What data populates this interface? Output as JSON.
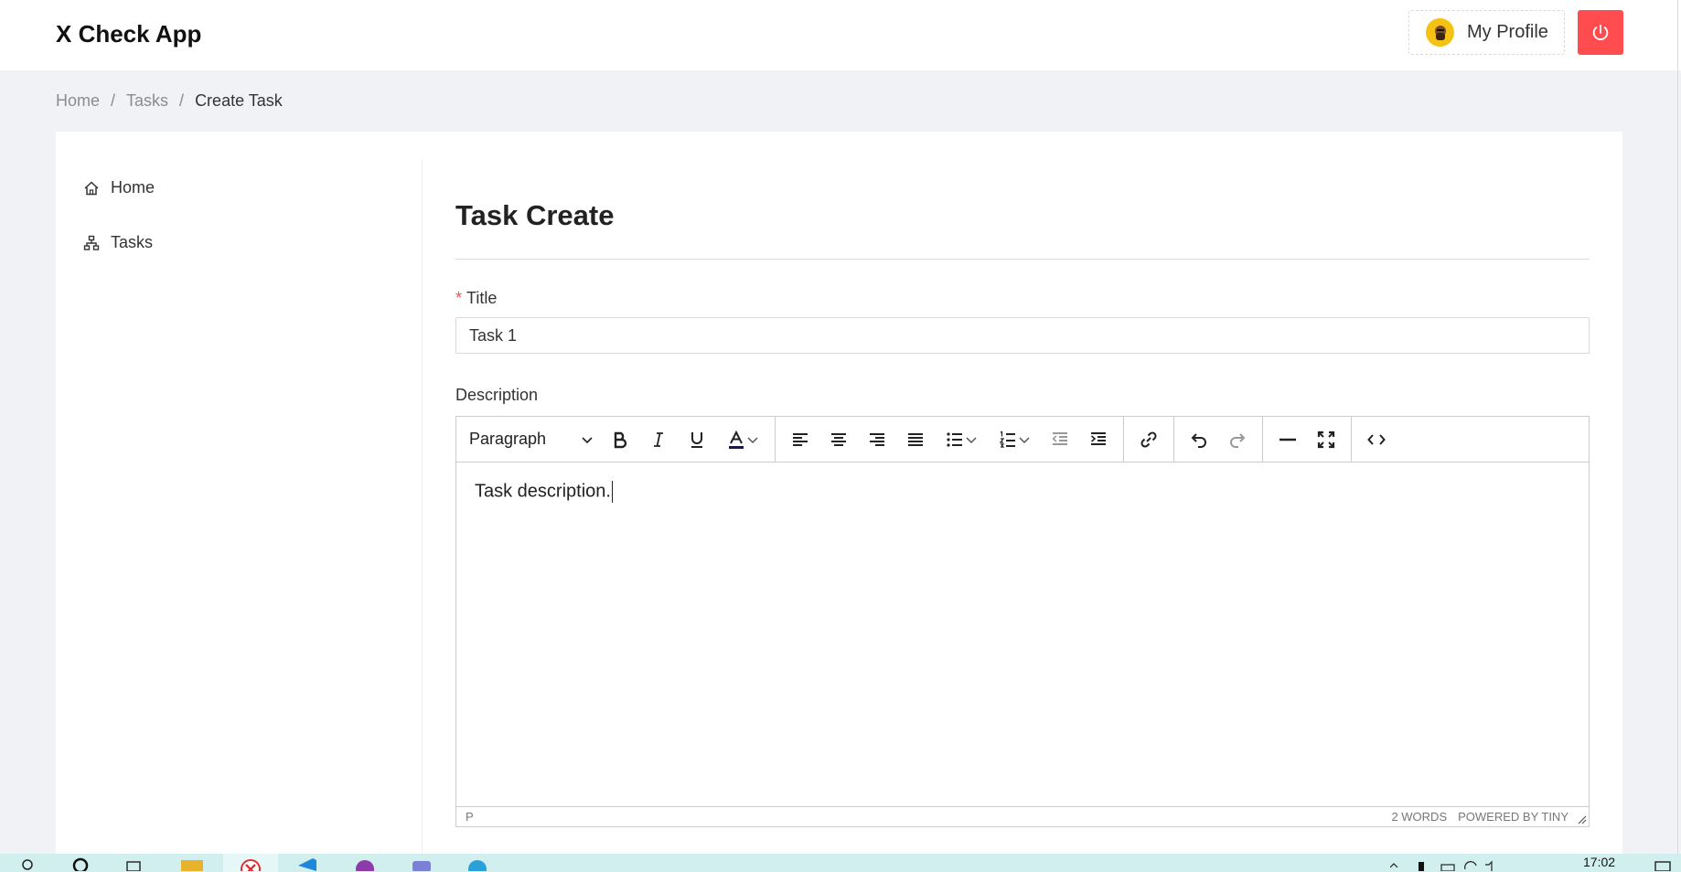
{
  "header": {
    "app_title": "X Check App",
    "profile_label": "My Profile"
  },
  "breadcrumb": [
    "Home",
    "Tasks",
    "Create Task"
  ],
  "sidebar": {
    "items": [
      {
        "label": "Home",
        "icon": "home-icon"
      },
      {
        "label": "Tasks",
        "icon": "sitemap-icon"
      }
    ]
  },
  "form": {
    "page_title": "Task Create",
    "title_label": "Title",
    "title_required_mark": "*",
    "title_value": "Task 1",
    "description_label": "Description"
  },
  "editor": {
    "block_format": "Paragraph",
    "content": "Task description.",
    "path": "P",
    "word_count": "2 WORDS",
    "branding": "POWERED BY TINY"
  },
  "taskbar": {
    "time": "17:02"
  },
  "colors": {
    "danger": "#ff4d4f",
    "avatar": "#f3c214",
    "taskbar": "#d2eff0"
  }
}
